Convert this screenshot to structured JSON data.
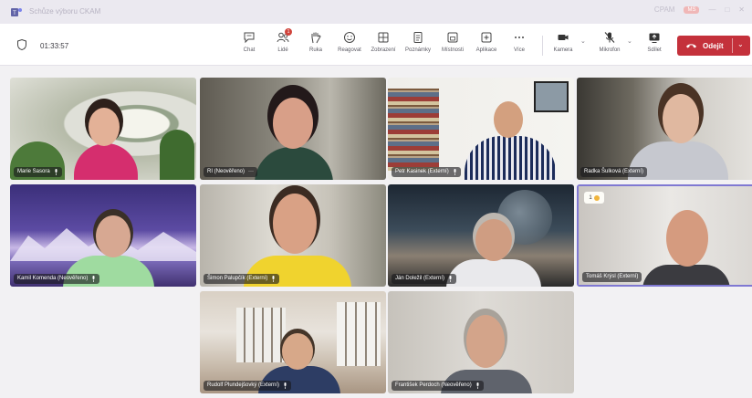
{
  "window": {
    "title": "Schůze výboru CKAM",
    "org_label": "CPAM",
    "org_badge": "MS",
    "minimize": "—",
    "maximize": "□",
    "close": "✕"
  },
  "toolbar": {
    "timer": "01:33:57",
    "items": [
      {
        "label": "Chat",
        "icon": "chat-icon"
      },
      {
        "label": "Lidé",
        "icon": "people-icon",
        "badge": "1"
      },
      {
        "label": "Ruka",
        "icon": "raise-hand-icon"
      },
      {
        "label": "Reagovat",
        "icon": "smiley-icon"
      },
      {
        "label": "Zobrazení",
        "icon": "view-grid-icon"
      },
      {
        "label": "Poznámky",
        "icon": "notes-icon"
      },
      {
        "label": "Místnosti",
        "icon": "rooms-icon"
      },
      {
        "label": "Aplikace",
        "icon": "add-apps-icon"
      },
      {
        "label": "Více",
        "icon": "more-icon"
      },
      {
        "label": "Kamera",
        "icon": "camera-icon"
      },
      {
        "label": "Mikrofon",
        "icon": "mic-off-icon"
      },
      {
        "label": "Sdílet",
        "icon": "share-icon"
      }
    ],
    "leave_label": "Odejít"
  },
  "participants": [
    {
      "name": "Marie Sasora"
    },
    {
      "name": "RI (Neověřeno)",
      "extra": "···"
    },
    {
      "name": "Petr Kasinek (Externí)"
    },
    {
      "name": "Radka Šulková (Externí)"
    },
    {
      "name": "Kamil Komenda (Neověřeno)"
    },
    {
      "name": "Šimon Palupčík (Externí)"
    },
    {
      "name": "Ján Doležil (Externí)"
    },
    {
      "name": "Tomáš Krýsl (Externí)",
      "hand_raised": "1"
    },
    {
      "name": "Rudolf Plundejšovký (Externí)"
    },
    {
      "name": "František Perdoch (Neověřeno)"
    }
  ],
  "colors": {
    "leave_red": "#c4313b",
    "active_speaker": "#7f78d2",
    "notification": "#d0443c"
  }
}
